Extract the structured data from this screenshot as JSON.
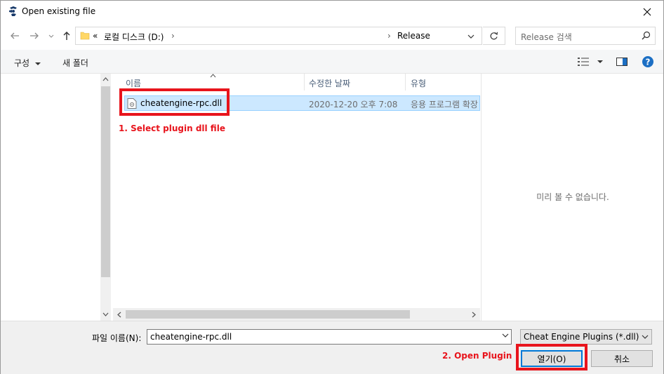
{
  "window": {
    "title": "Open existing file"
  },
  "address": {
    "prefix": "«",
    "crumb1": "로컬 디스크 (D:)",
    "sep1": "›",
    "sep2": "›",
    "crumb2": "Release"
  },
  "search": {
    "placeholder": "Release 검색"
  },
  "toolbar": {
    "organize": "구성",
    "new_folder": "새 폴더"
  },
  "list": {
    "columns": [
      "이름",
      "수정한 날짜",
      "유형"
    ],
    "rows": [
      {
        "name": "cheatengine-rpc.dll",
        "modified": "2020-12-20 오후 7:08",
        "type": "응용 프로그램 확장"
      }
    ]
  },
  "preview": {
    "empty_text": "미리 볼 수 없습니다."
  },
  "bottom": {
    "filename_label": "파일 이름(N):",
    "filename_value": "cheatengine-rpc.dll",
    "filter_value": "Cheat Engine Plugins (*.dll)",
    "open_label": "열기(O)",
    "cancel_label": "취소"
  },
  "annotations": {
    "step1": "1. Select plugin dll file",
    "step2": "2. Open Plugin"
  },
  "colors": {
    "annotation": "#e8141c",
    "selection": "#cce8ff",
    "accent": "#0078d7"
  }
}
